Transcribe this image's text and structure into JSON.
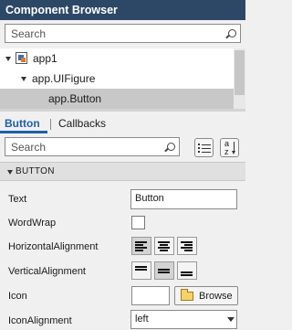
{
  "window": {
    "title": "Component Browser"
  },
  "component_search": {
    "placeholder": "Search",
    "icon": "search-icon"
  },
  "tree": {
    "items": [
      {
        "label": "app1",
        "icon": "app-icon",
        "expanded": true
      },
      {
        "label": "app.UIFigure",
        "expanded": true
      },
      {
        "label": "app.Button",
        "selected": true
      }
    ]
  },
  "tabs": {
    "button": "Button",
    "callbacks": "Callbacks",
    "active": "Button"
  },
  "property_search": {
    "placeholder": "Search",
    "icon": "search-icon"
  },
  "view_buttons": {
    "list_view": "list-view-icon",
    "sort": "sort-az-icon",
    "sort_a": "a",
    "sort_z": "z"
  },
  "section": {
    "title": "BUTTON",
    "expanded": true
  },
  "properties": {
    "text": {
      "label": "Text",
      "value": "Button"
    },
    "wordwrap": {
      "label": "WordWrap",
      "checked": false
    },
    "horizontal_alignment": {
      "label": "HorizontalAlignment",
      "options": [
        "left",
        "center",
        "right"
      ],
      "selected": "left"
    },
    "vertical_alignment": {
      "label": "VerticalAlignment",
      "options": [
        "top",
        "center",
        "bottom"
      ],
      "selected": "center"
    },
    "icon": {
      "label": "Icon",
      "value": "",
      "browse_label": "Browse"
    },
    "icon_alignment": {
      "label": "IconAlignment",
      "value": "left"
    }
  },
  "colors": {
    "title_bar": "#2d4867",
    "selection": "#c8c8c8",
    "accent": "#1f5fa8"
  }
}
